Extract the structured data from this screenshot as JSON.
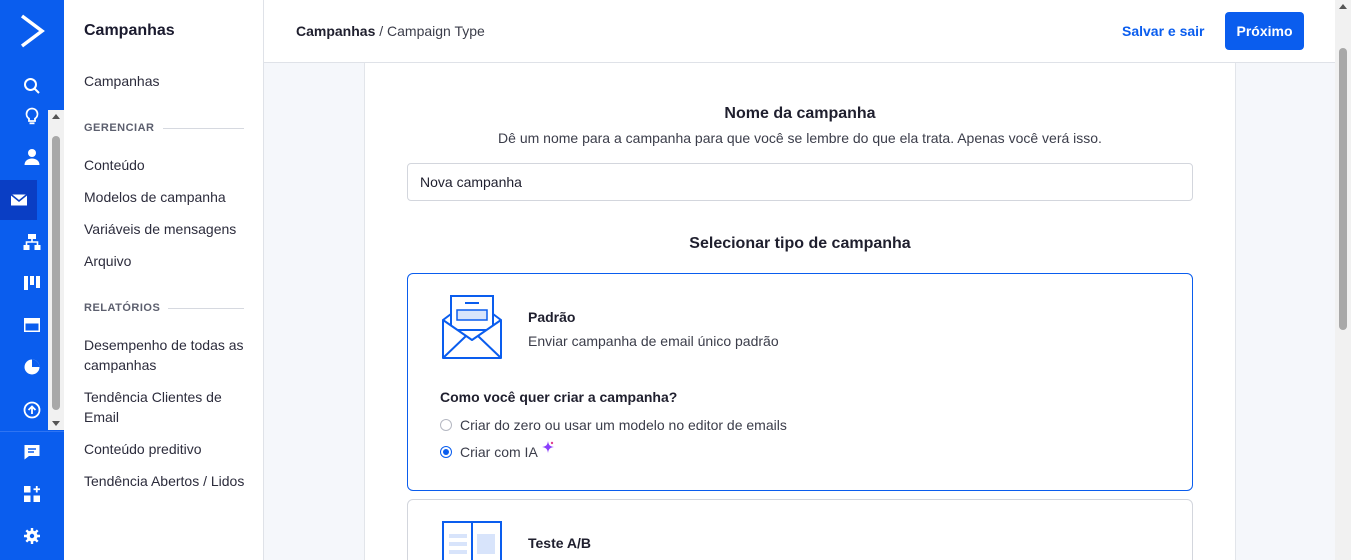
{
  "colors": {
    "brand": "#0a5dee",
    "rail_active": "#0a3ec4"
  },
  "rail": {
    "icons": [
      "logo-chevron-icon",
      "search-icon",
      "lightbulb-icon",
      "person-icon",
      "envelope-icon",
      "flowchart-icon",
      "board-icon",
      "window-icon",
      "pie-chart-icon",
      "upload-icon",
      "chat-icon",
      "apps-icon",
      "gear-icon"
    ]
  },
  "subnav": {
    "title": "Campanhas",
    "top_link": "Campanhas",
    "manage_label": "GERENCIAR",
    "manage_items": [
      "Conteúdo",
      "Modelos de campanha",
      "Variáveis de mensagens",
      "Arquivo"
    ],
    "reports_label": "RELATÓRIOS",
    "reports_items": [
      "Desempenho de todas as campanhas",
      "Tendência Clientes de Email",
      "Conteúdo preditivo",
      "Tendência Abertos / Lidos"
    ]
  },
  "topbar": {
    "crumb_root": "Campanhas",
    "crumb_sep": " / ",
    "crumb_current": "Campaign Type",
    "save_label": "Salvar e sair",
    "next_label": "Próximo"
  },
  "form": {
    "name_title": "Nome da campanha",
    "name_subtitle": "Dê um nome para a campanha para que você se lembre do que ela trata. Apenas você verá isso.",
    "name_value": "Nova campanha",
    "type_title": "Selecionar tipo de campanha",
    "options": [
      {
        "title": "Padrão",
        "desc": "Enviar campanha de email único padrão",
        "question": "Como você quer criar a campanha?",
        "choices": [
          "Criar do zero ou usar um modelo no editor de emails",
          "Criar com IA"
        ],
        "selected_choice": "Criar com IA"
      },
      {
        "title": "Teste A/B"
      }
    ]
  }
}
